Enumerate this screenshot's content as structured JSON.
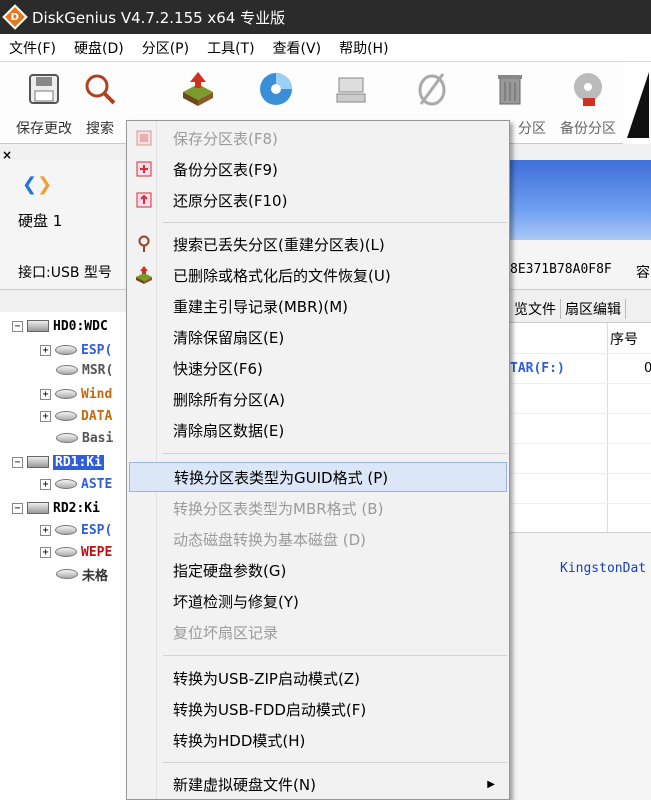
{
  "window": {
    "title": "DiskGenius V4.7.2.155 x64 专业版",
    "app_icon_letter": "D"
  },
  "menubar": {
    "items": [
      "文件(F)",
      "硬盘(D)",
      "分区(P)",
      "工具(T)",
      "查看(V)",
      "帮助(H)"
    ]
  },
  "toolbar": {
    "save": "保存更改",
    "search": "搜索",
    "delete_partition_partial": "分区",
    "backup_partition": "备份分区"
  },
  "left": {
    "close": "×",
    "disk_label": "硬盘 1",
    "port_label": "接口:USB  型号",
    "tree": [
      {
        "label": "HD0:WDC",
        "kind": "disk",
        "selected": false
      },
      {
        "label": "ESP(",
        "kind": "part",
        "selected": false
      },
      {
        "label": "MSR(",
        "kind": "part",
        "selected": false
      },
      {
        "label": "Wind",
        "kind": "part",
        "selected": false
      },
      {
        "label": "DATA",
        "kind": "part",
        "selected": false
      },
      {
        "label": "Basi",
        "kind": "part",
        "selected": false
      },
      {
        "label": "RD1:Ki",
        "kind": "disk",
        "selected": true
      },
      {
        "label": "ASTE",
        "kind": "part",
        "selected": false
      },
      {
        "label": "RD2:Ki",
        "kind": "disk",
        "selected": false
      },
      {
        "label": "ESP(",
        "kind": "part",
        "selected": false
      },
      {
        "label": "WEPE",
        "kind": "part",
        "selected": false
      },
      {
        "label": "未格",
        "kind": "part",
        "selected": false
      }
    ]
  },
  "right": {
    "serial": "8E371B78A0F8F",
    "cap": "容",
    "tabs": [
      "览文件",
      "扇区编辑"
    ],
    "col_header": "序号",
    "row1_label": "TAR(F:)",
    "row1_num": "0",
    "kingston": "KingstonDat"
  },
  "context_menu": {
    "items": [
      {
        "label": "保存分区表(F8)",
        "disabled": true,
        "icon": "save-table-icon"
      },
      {
        "label": "备份分区表(F9)",
        "disabled": false,
        "icon": "backup-table-icon"
      },
      {
        "label": "还原分区表(F10)",
        "disabled": false,
        "icon": "restore-table-icon"
      },
      {
        "label": "搜索已丢失分区(重建分区表)(L)",
        "disabled": false,
        "icon": "search-icon"
      },
      {
        "label": "已删除或格式化后的文件恢复(U)",
        "disabled": false,
        "icon": "recover-icon"
      },
      {
        "label": "重建主引导记录(MBR)(M)",
        "disabled": false
      },
      {
        "label": "清除保留扇区(E)",
        "disabled": false
      },
      {
        "label": "快速分区(F6)",
        "disabled": false
      },
      {
        "label": "删除所有分区(A)",
        "disabled": false
      },
      {
        "label": "清除扇区数据(E)",
        "disabled": false
      },
      {
        "label": "转换分区表类型为GUID格式 (P)",
        "disabled": false,
        "highlighted": true
      },
      {
        "label": "转换分区表类型为MBR格式 (B)",
        "disabled": true
      },
      {
        "label": "动态磁盘转换为基本磁盘 (D)",
        "disabled": true
      },
      {
        "label": "指定硬盘参数(G)",
        "disabled": false
      },
      {
        "label": "坏道检测与修复(Y)",
        "disabled": false
      },
      {
        "label": "复位坏扇区记录",
        "disabled": true
      },
      {
        "label": "转换为USB-ZIP启动模式(Z)",
        "disabled": false
      },
      {
        "label": "转换为USB-FDD启动模式(F)",
        "disabled": false
      },
      {
        "label": "转换为HDD模式(H)",
        "disabled": false
      },
      {
        "label": "新建虚拟硬盘文件(N)",
        "disabled": false,
        "submenu": true
      }
    ],
    "submenu_arrow": "▶"
  },
  "colors": {
    "highlight": "#dbe6f7",
    "selection": "#2f5ed8",
    "titlebar": "#2b2b2b"
  }
}
